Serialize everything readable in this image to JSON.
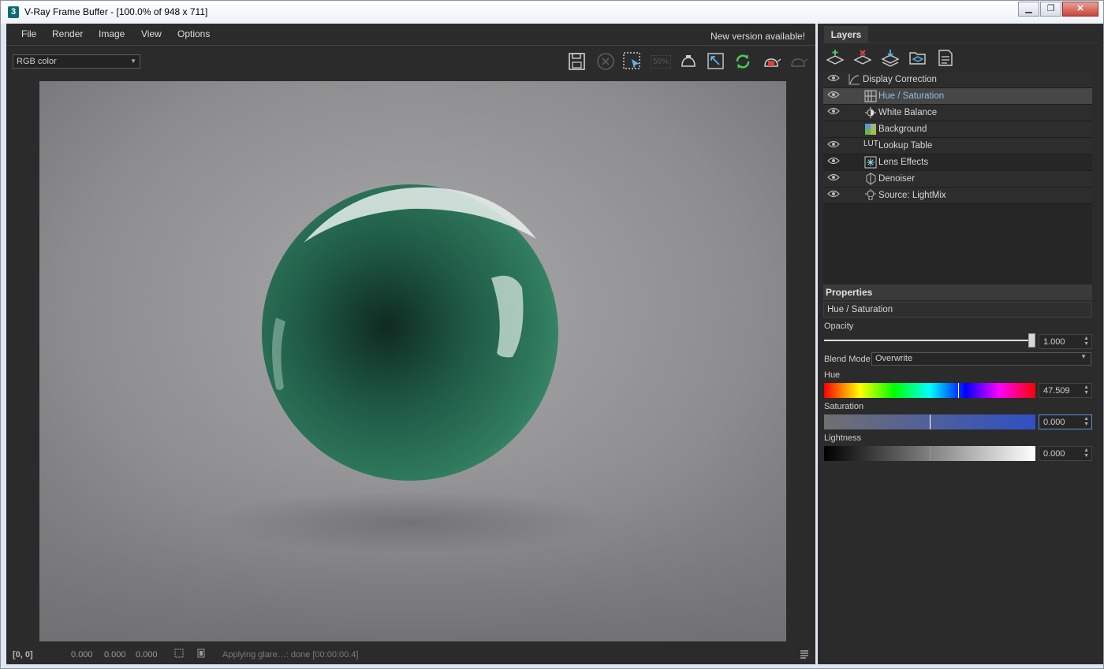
{
  "window": {
    "title": "V-Ray Frame Buffer - [100.0% of 948 x 711]",
    "app_icon": "3",
    "controls": [
      "minimize-icon",
      "restore-icon",
      "close-icon"
    ]
  },
  "menu": {
    "items": [
      "File",
      "Render",
      "Image",
      "View",
      "Options"
    ],
    "notice": "New version available!"
  },
  "toolbar": {
    "channel": "RGB color",
    "zoom_label": "50%",
    "icons": [
      "save-icon",
      "stop-icon",
      "region-render-icon",
      "zoom-50-icon",
      "track-mouse-icon",
      "follow-mouse-icon",
      "refresh-icon",
      "render-teapot-icon",
      "render-interactive-icon"
    ]
  },
  "status": {
    "coords": "[0, 0]",
    "r": "0.000",
    "g": "0.000",
    "b": "0.000",
    "message": "Applying glare…: done [00:00:00.4]"
  },
  "layers_panel": {
    "tab": "Layers",
    "toolbar_icons": [
      "add-layer-icon",
      "delete-layer-icon",
      "merge-layers-icon",
      "load-preset-icon",
      "save-preset-icon"
    ],
    "items": [
      {
        "label": "Display Correction",
        "visible": true,
        "icon": "curve-icon",
        "selected": false
      },
      {
        "label": "Hue / Saturation",
        "visible": true,
        "icon": "hue-saturation-icon",
        "selected": true
      },
      {
        "label": "White Balance",
        "visible": true,
        "icon": "white-balance-icon",
        "selected": false
      },
      {
        "label": "Background",
        "visible": false,
        "icon": "background-icon",
        "selected": false
      },
      {
        "label": "Lookup Table",
        "visible": true,
        "icon": "lut-icon",
        "icon_text": "LUT",
        "selected": false
      },
      {
        "label": "Lens Effects",
        "visible": true,
        "icon": "lens-effects-icon",
        "selected": false
      },
      {
        "label": "Denoiser",
        "visible": true,
        "icon": "denoiser-icon",
        "selected": false
      },
      {
        "label": "Source: LightMix",
        "visible": true,
        "icon": "lightmix-icon",
        "selected": false
      }
    ]
  },
  "properties": {
    "header": "Properties",
    "layer_name": "Hue / Saturation",
    "opacity_label": "Opacity",
    "opacity": "1.000",
    "opacity_level": 1.0,
    "blend_label": "Blend Mode",
    "blend_mode": "Overwrite",
    "hue_label": "Hue",
    "hue": "47.509",
    "hue_marker": 0.635,
    "saturation_label": "Saturation",
    "saturation": "0.000",
    "saturation_marker": 0.5,
    "lightness_label": "Lightness",
    "lightness": "0.000",
    "lightness_marker": 0.5
  },
  "colors": {
    "panel_bg": "#2b2b2b",
    "selection_text": "#8fbfe6",
    "sphere": "#2f7a5d",
    "annotation_arrow": "#e02020"
  }
}
